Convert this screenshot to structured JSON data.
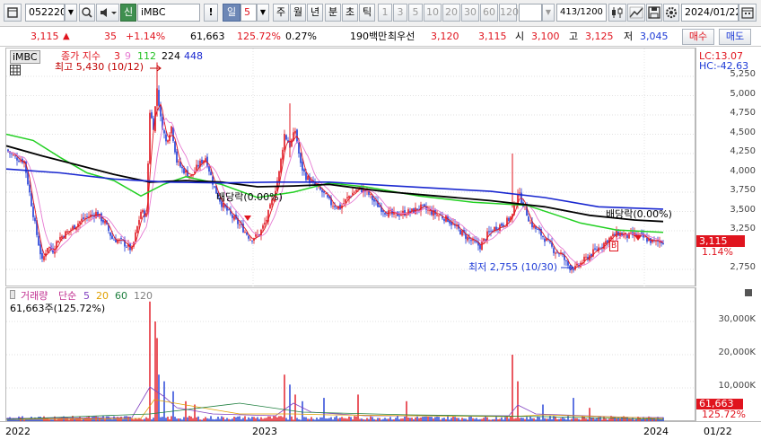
{
  "toolbar": {
    "window_icon": "window-icon",
    "stock_code": "052220",
    "market_tag": "신",
    "stock_name": "iMBC",
    "alert_label": "!",
    "period_unit": "일",
    "period_count": "5",
    "period_week": "주",
    "period_month": "월",
    "period_year": "년",
    "period_minute": "분",
    "period_second": "초",
    "period_tick": "틱",
    "interval_1": "1",
    "interval_3": "3",
    "interval_5": "5",
    "interval_10": "10",
    "interval_20": "20",
    "interval_30": "30",
    "interval_60": "60",
    "interval_120": "120",
    "data_count": "413",
    "data_total": "/1200",
    "date_value": "2024/01/22"
  },
  "pricebar": {
    "price": "3,115",
    "change_arrow": "▲",
    "change": "35",
    "change_pct": "+1.14%",
    "volume": "61,663",
    "volume_ratio": "125.72%",
    "turnover_pct": "0.27%",
    "amount": "190백만",
    "quote_label": "최우선",
    "ask": "3,120",
    "bid": "3,115",
    "open_label": "시",
    "open": "3,100",
    "high_label": "고",
    "high": "3,125",
    "low_label": "저",
    "low": "3,045",
    "buy_label": "매수",
    "sell_label": "매도"
  },
  "price_chart": {
    "symbol": "iMBC",
    "legend_label": "종가 지수",
    "ma": [
      "3",
      "9",
      "112",
      "224",
      "448"
    ],
    "lc": "LC:13.07",
    "hc": "HC:-42.63",
    "y_ticks": [
      "5,250",
      "5,000",
      "4,750",
      "4,500",
      "4,250",
      "4,000",
      "3,750",
      "3,500",
      "3,250",
      "2,750"
    ],
    "price_tag": "3,115",
    "pct_tag": "1.14%",
    "high_annot": "최고 5,430 (10/12)",
    "low_annot": "최저 2,755 (10/30)",
    "dividend_annot_1": "배당락(0.00%)",
    "dividend_annot_2": "배당락(0.00%)",
    "b_marker": "B"
  },
  "volume_chart": {
    "label": "거래량",
    "ma_type": "단순",
    "ma": [
      "5",
      "20",
      "60",
      "120"
    ],
    "volume_text": "61,663주(125.72%)",
    "y_ticks": [
      "30,000K",
      "20,000K",
      "10,000K"
    ],
    "volume_tag": "61,663",
    "pct_tag": "125.72%"
  },
  "x_axis": {
    "labels": [
      "2022",
      "2023",
      "2024"
    ],
    "date_tag": "01/22"
  },
  "colors": {
    "up": "#e0141e",
    "down": "#1d3ad6",
    "ma3": "#e0141e",
    "ma9": "#e67ad2",
    "ma112": "#22d022",
    "ma224": "#000000",
    "ma448": "#1a28d0"
  }
}
